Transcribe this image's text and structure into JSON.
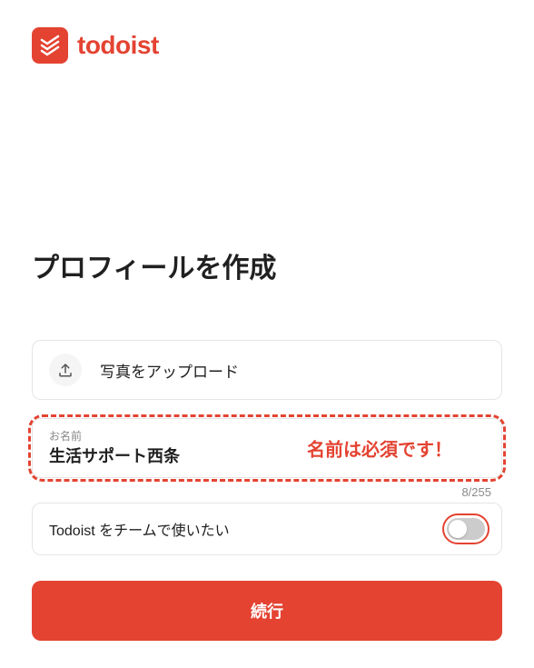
{
  "brand": {
    "name": "todoist"
  },
  "page": {
    "title": "プロフィールを作成"
  },
  "upload": {
    "label": "写真をアップロード"
  },
  "name_field": {
    "label": "お名前",
    "value": "生活サポート西条",
    "annotation": "名前は必須です！",
    "counter": "8/255"
  },
  "team_toggle": {
    "label": "Todoist をチームで使いたい",
    "on": false
  },
  "continue": {
    "label": "続行"
  }
}
